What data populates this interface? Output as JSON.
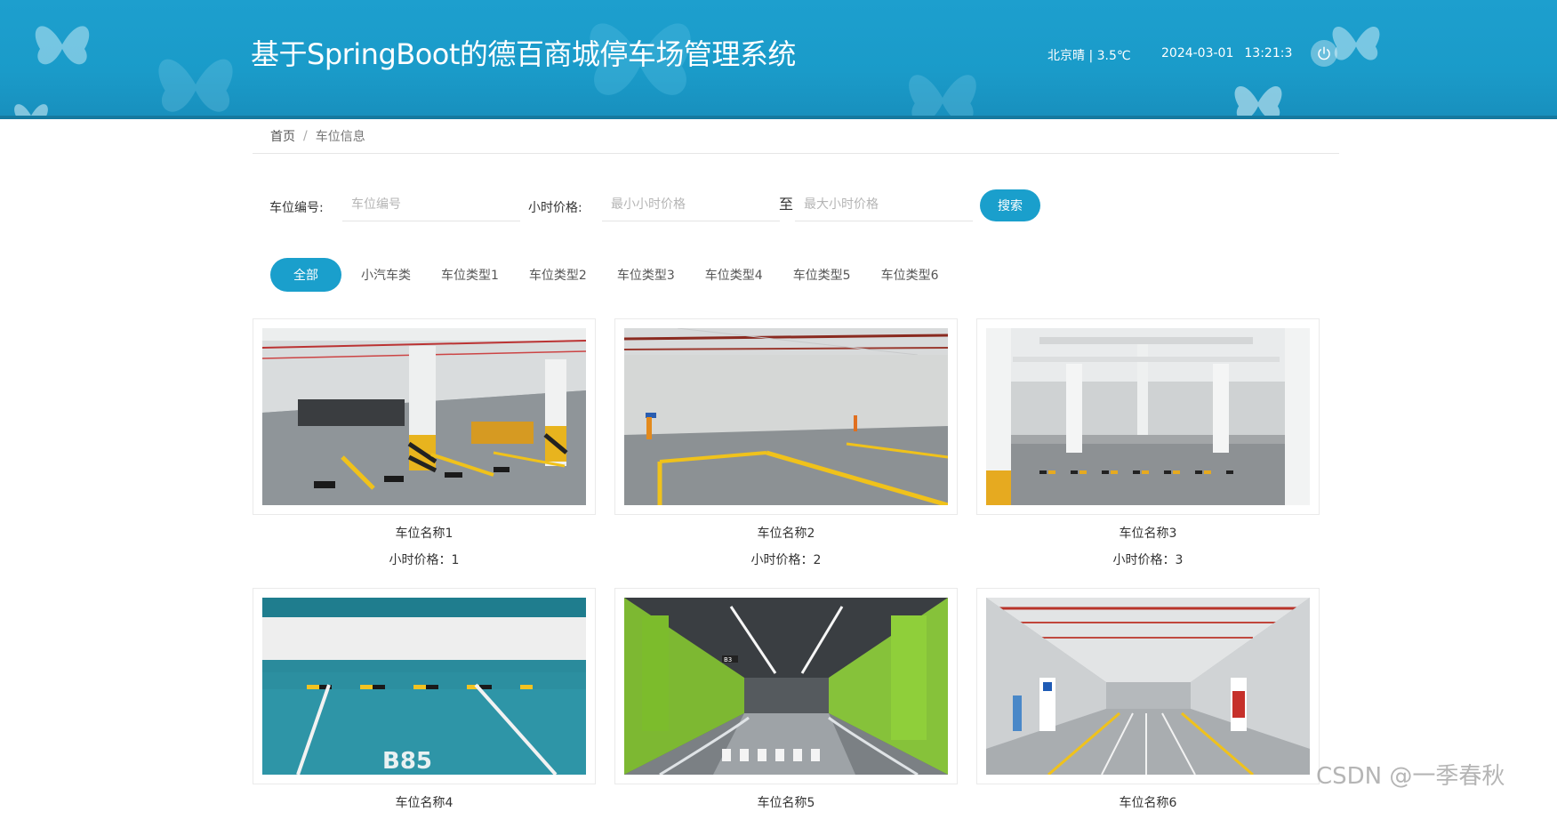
{
  "header": {
    "title": "基于SpringBoot的德百商城停车场管理系统",
    "weather": "北京晴 | 3.5℃",
    "date": "2024-03-01",
    "time": "13:21:3",
    "power_icon": "power-icon"
  },
  "breadcrumb": {
    "home": "首页",
    "separator": "/",
    "current": "车位信息"
  },
  "search": {
    "code_label": "车位编号:",
    "code_placeholder": "车位编号",
    "price_label": "小时价格:",
    "min_placeholder": "最小小时价格",
    "to": "至",
    "max_placeholder": "最大小时价格",
    "button": "搜索"
  },
  "tabs": [
    {
      "label": "全部",
      "active": true
    },
    {
      "label": "小汽车类",
      "active": false
    },
    {
      "label": "车位类型1",
      "active": false
    },
    {
      "label": "车位类型2",
      "active": false
    },
    {
      "label": "车位类型3",
      "active": false
    },
    {
      "label": "车位类型4",
      "active": false
    },
    {
      "label": "车位类型5",
      "active": false
    },
    {
      "label": "车位类型6",
      "active": false
    }
  ],
  "cards": [
    {
      "name": "车位名称1",
      "price": "小时价格：1",
      "scene": "parking-garage-yellow-stripes"
    },
    {
      "name": "车位名称2",
      "price": "小时价格：2",
      "scene": "parking-garage-grey-wall"
    },
    {
      "name": "车位名称3",
      "price": "小时价格：3",
      "scene": "parking-garage-white-pillars"
    },
    {
      "name": "车位名称4",
      "price": "",
      "scene": "parking-bay-teal-b85"
    },
    {
      "name": "车位名称5",
      "price": "",
      "scene": "parking-garage-green-walls"
    },
    {
      "name": "车位名称6",
      "price": "",
      "scene": "parking-garage-red-pipes"
    }
  ],
  "card4_bay_text": "B85",
  "card5_sign_text": "B3",
  "watermark": "CSDN @一季春秋",
  "colors": {
    "header": "#1d9fce",
    "accent": "#1a9fcc"
  }
}
